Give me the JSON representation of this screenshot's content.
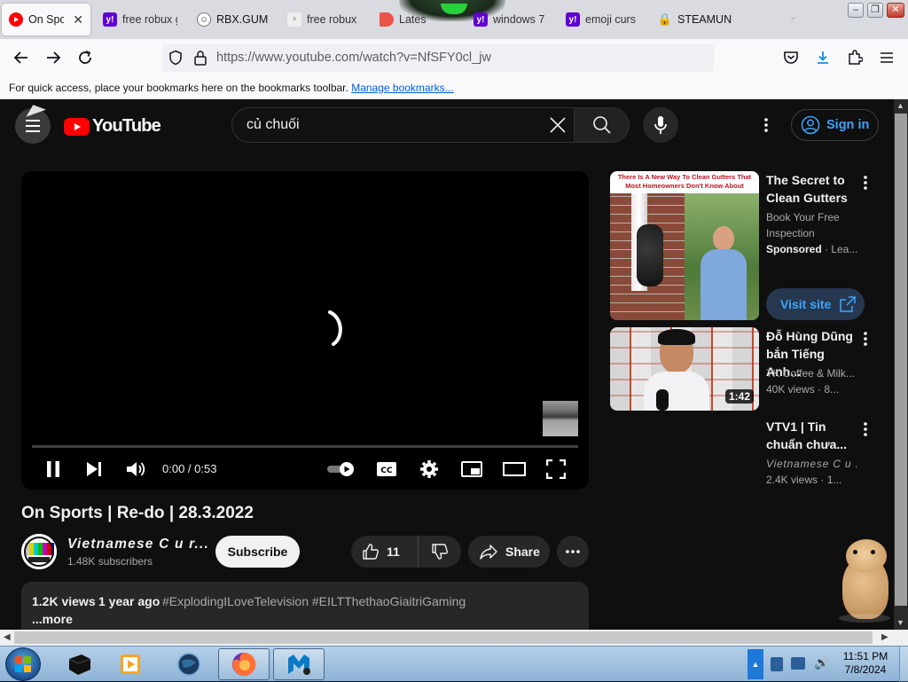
{
  "browser": {
    "tabs": [
      {
        "title": "On Spor",
        "favicon": "youtube-favicon",
        "active": true
      },
      {
        "title": "free robux g",
        "favicon": "yahoo-favicon"
      },
      {
        "title": "RBX.GUM",
        "favicon": "rbx-favicon"
      },
      {
        "title": "free robux",
        "favicon": "search-results-favicon"
      },
      {
        "title": "Lates",
        "favicon": "tag-favicon"
      },
      {
        "title": "windows 7",
        "favicon": "yahoo-favicon"
      },
      {
        "title": "emoji curs",
        "favicon": "yahoo-favicon"
      },
      {
        "title": "STEAMUNL",
        "favicon": "steamunlocked-favicon"
      }
    ],
    "tab_close_glyph": "✕",
    "url": "https://www.youtube.com/watch?v=NfSFY0cl_jw",
    "bookmark_bar_text": "For quick access, place your bookmarks here on the bookmarks toolbar.",
    "bookmark_bar_link": "Manage bookmarks...",
    "window_buttons": [
      "minimize",
      "maximize",
      "close"
    ]
  },
  "youtube": {
    "logo_text": "YouTube",
    "search_value": "củ chuối",
    "sign_in_label": "Sign in",
    "player": {
      "time": "0:00 / 0:53",
      "progress_fraction": 0,
      "state": "loading"
    },
    "video": {
      "title": "On Sports | Re-do | 28.3.2022",
      "channel_name": "Vietnamese C u r...",
      "subscribers": "1.48K subscribers",
      "subscribe_label": "Subscribe",
      "likes": "11",
      "share_label": "Share",
      "views": "1.2K views",
      "age": "1 year ago",
      "tags": "#ExplodingILoveTelevision #EILTThethaoGiaitriGaming",
      "more_label": "...more"
    },
    "sidebar": [
      {
        "kind": "ad",
        "thumb_caption": "There Is A New Way To Clean Gutters That Most Homeowners Don't Know About",
        "title_line1": "The Secret to",
        "title_line2": "Clean Gutters",
        "desc_line1": "Book Your Free",
        "desc_line2": "Inspection",
        "sponsored": "Sponsored",
        "advertiser": " · Lea...",
        "cta": "Visit site"
      },
      {
        "kind": "video",
        "title_line1": "Đỗ Hùng Dũng",
        "title_line2": "bắn Tiếng Anh...",
        "channel": "TK Coffee & Milk...",
        "meta": "40K views · 8...",
        "duration": "1:42"
      },
      {
        "kind": "video",
        "title_line1": "VTV1 | Tin",
        "title_line2": "chuẩn chưa...",
        "channel": "Vietnamese C u ...",
        "meta": "2.4K views · 1..."
      }
    ]
  },
  "taskbar": {
    "clock_time": "11:51 PM",
    "clock_date": "7/8/2024",
    "apps": [
      "start-orb",
      "black-cube-app",
      "media-player-app",
      "globe-app",
      "firefox-app",
      "malwarebytes-app"
    ]
  }
}
